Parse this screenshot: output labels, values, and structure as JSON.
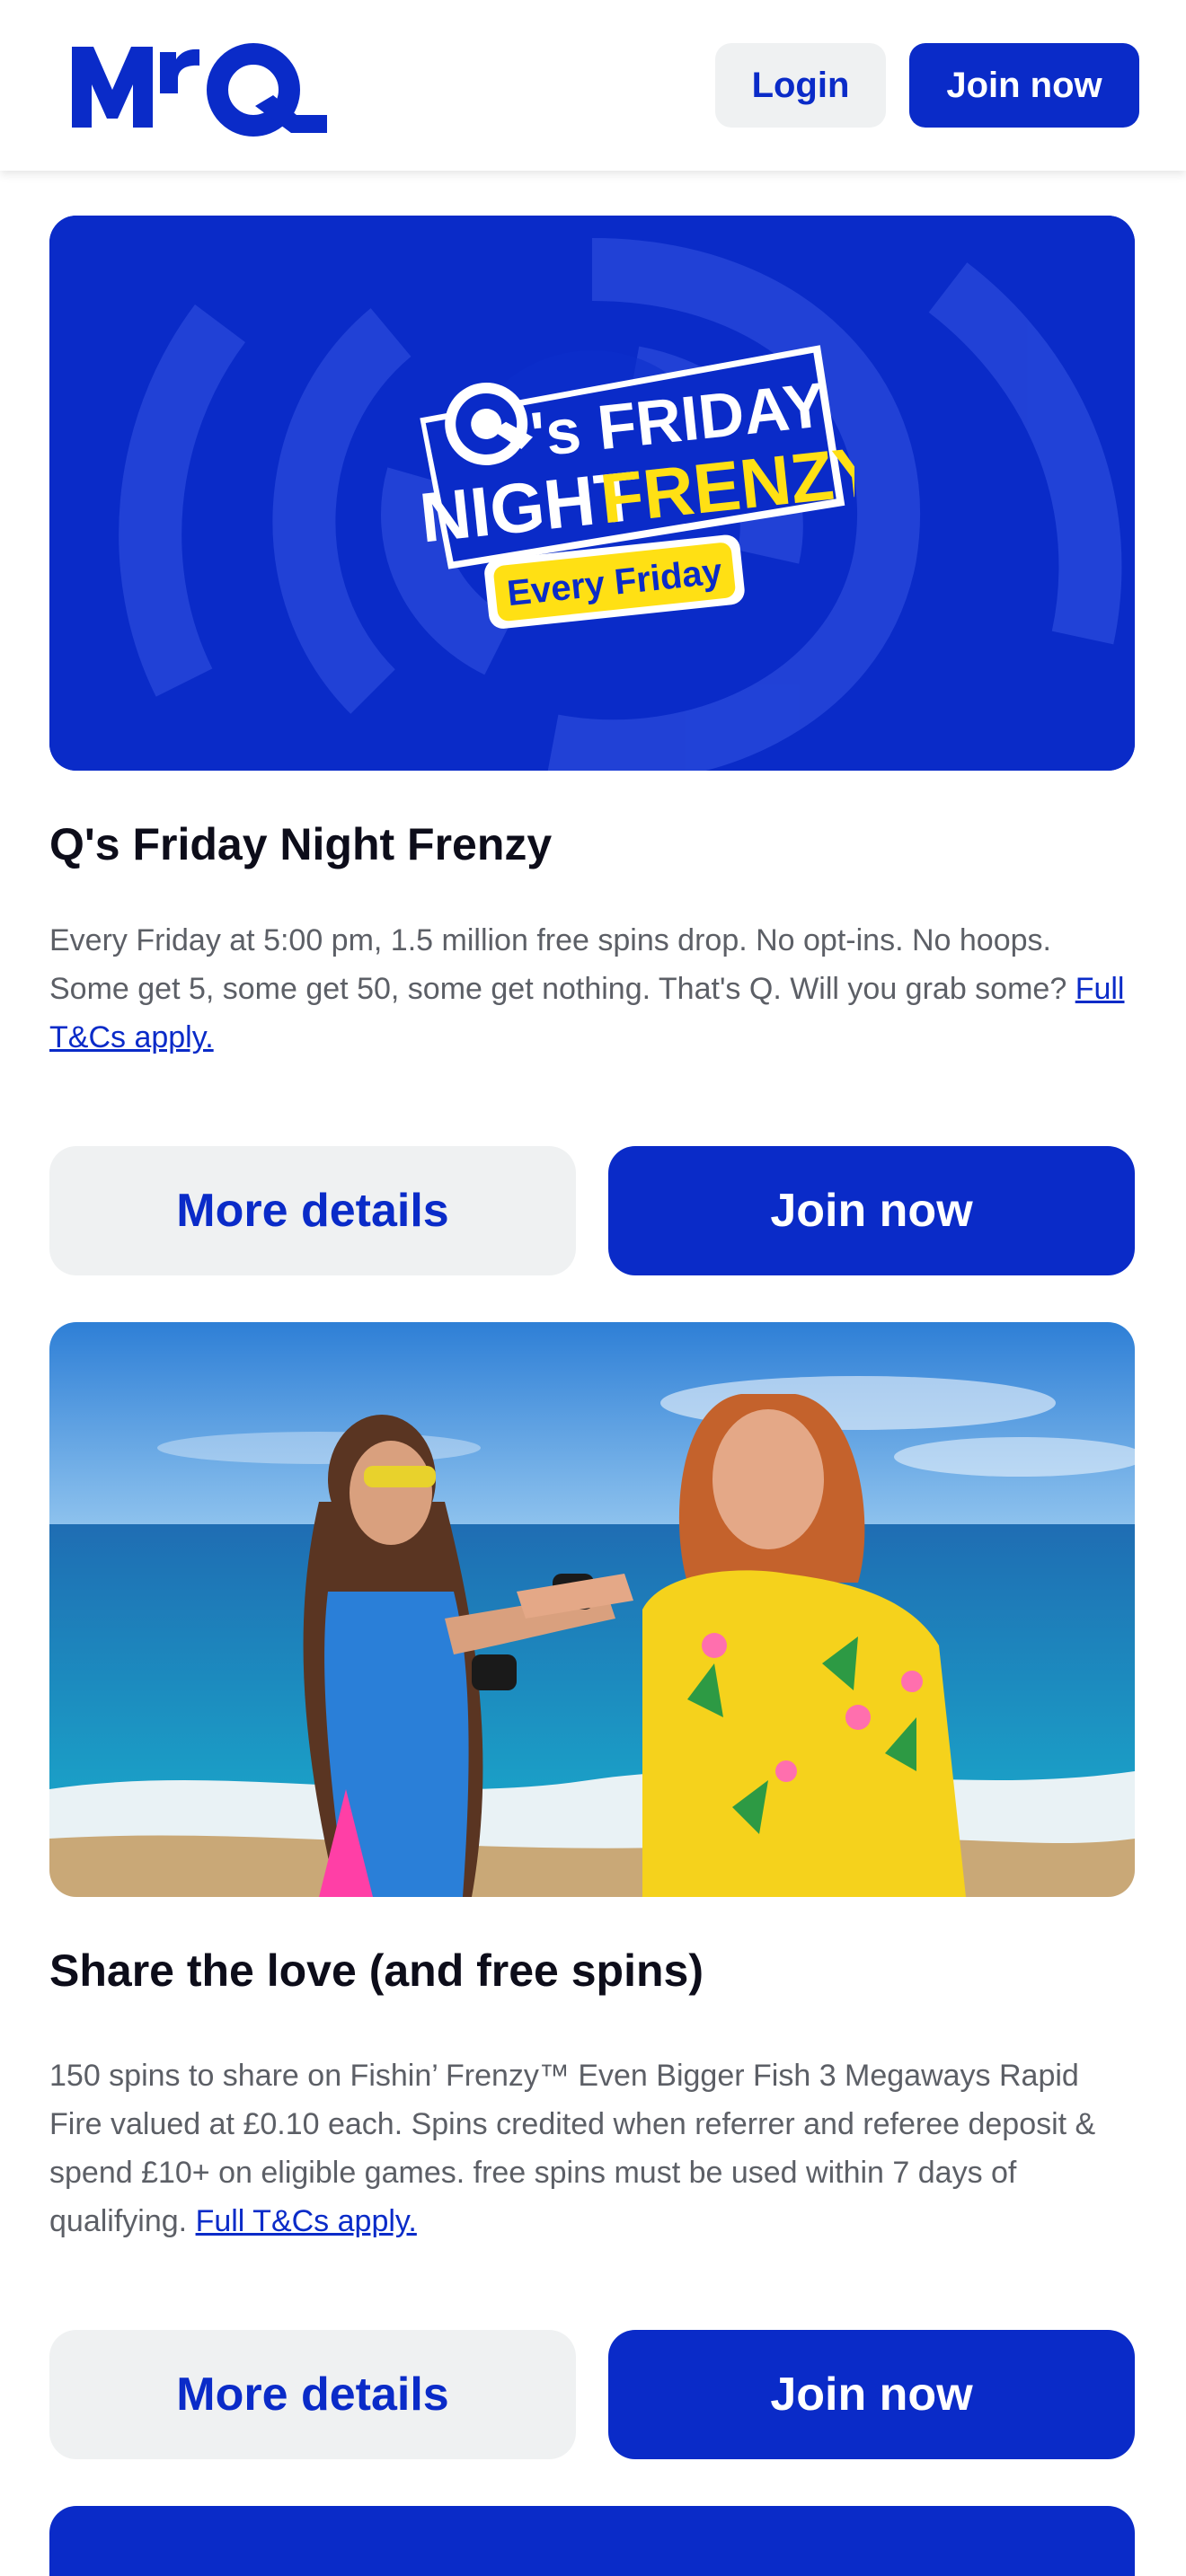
{
  "header": {
    "logo_text": "MrQ",
    "login_label": "Login",
    "join_label": "Join now"
  },
  "promos": [
    {
      "banner_text": {
        "line1_q": "Q",
        "line1_rest": "'s FRIDAY",
        "line2_a": "NIGHT",
        "line2_b": "FRENZY",
        "badge": "Every Friday"
      },
      "title": "Q's Friday Night Frenzy",
      "description": "Every Friday at 5:00 pm, 1.5 million free spins drop. No opt-ins. No hoops. Some get 5, some get 50, some get nothing. That's Q. Will you grab some?",
      "link_label": "Full T&Cs apply.",
      "details_label": "More details",
      "join_label": "Join now"
    },
    {
      "title": "Share the love (and free spins)",
      "description": "150 spins to share on Fishin’ Frenzy™ Even Bigger Fish 3 Megaways Rapid Fire valued at £0.10 each. Spins credited when referrer and referee deposit & spend £10+ on eligible games. free spins must be used within 7 days of qualifying.",
      "link_label": "Full T&Cs apply.",
      "details_label": "More details",
      "join_label": "Join now"
    }
  ],
  "colors": {
    "brand_blue": "#0a2bc8",
    "accent_yellow": "#ffe014",
    "light_button": "#eff1f2",
    "body_text": "#5c5f66"
  }
}
